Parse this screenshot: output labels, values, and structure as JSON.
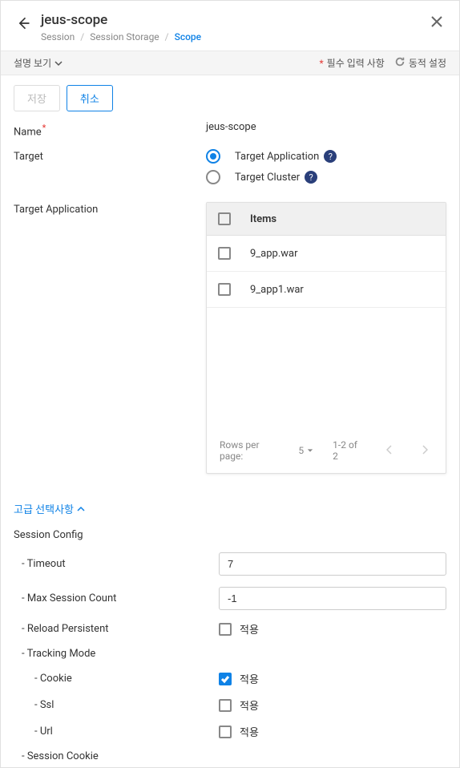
{
  "header": {
    "title": "jeus-scope",
    "breadcrumb": [
      "Session",
      "Session Storage",
      "Scope"
    ]
  },
  "toolbar": {
    "desc_toggle": "설명 보기",
    "required_label": "필수 입력 사항",
    "dynamic_label": "동적 설정"
  },
  "actions": {
    "save": "저장",
    "cancel": "취소"
  },
  "form": {
    "name_label": "Name",
    "name_value": "jeus-scope",
    "target_label": "Target",
    "target_options": [
      {
        "label": "Target Application",
        "checked": true
      },
      {
        "label": "Target Cluster",
        "checked": false
      }
    ],
    "target_app_label": "Target Application",
    "table": {
      "header": "Items",
      "rows": [
        "9_app.war",
        "9_app1.war"
      ],
      "rows_per_page_label": "Rows per page:",
      "rows_per_page_value": "5",
      "range": "1-2 of 2"
    }
  },
  "advanced_toggle": "고급 선택사항",
  "config": {
    "section_title": "Session Config",
    "timeout_label": "- Timeout",
    "timeout_value": "7",
    "max_session_label": "- Max Session Count",
    "max_session_value": "-1",
    "reload_persistent_label": "- Reload Persistent",
    "tracking_mode_label": "- Tracking Mode",
    "cookie_label": "- Cookie",
    "ssl_label": "- Ssl",
    "url_label": "- Url",
    "session_cookie_label": "- Session Cookie",
    "apply_label": "적용"
  }
}
